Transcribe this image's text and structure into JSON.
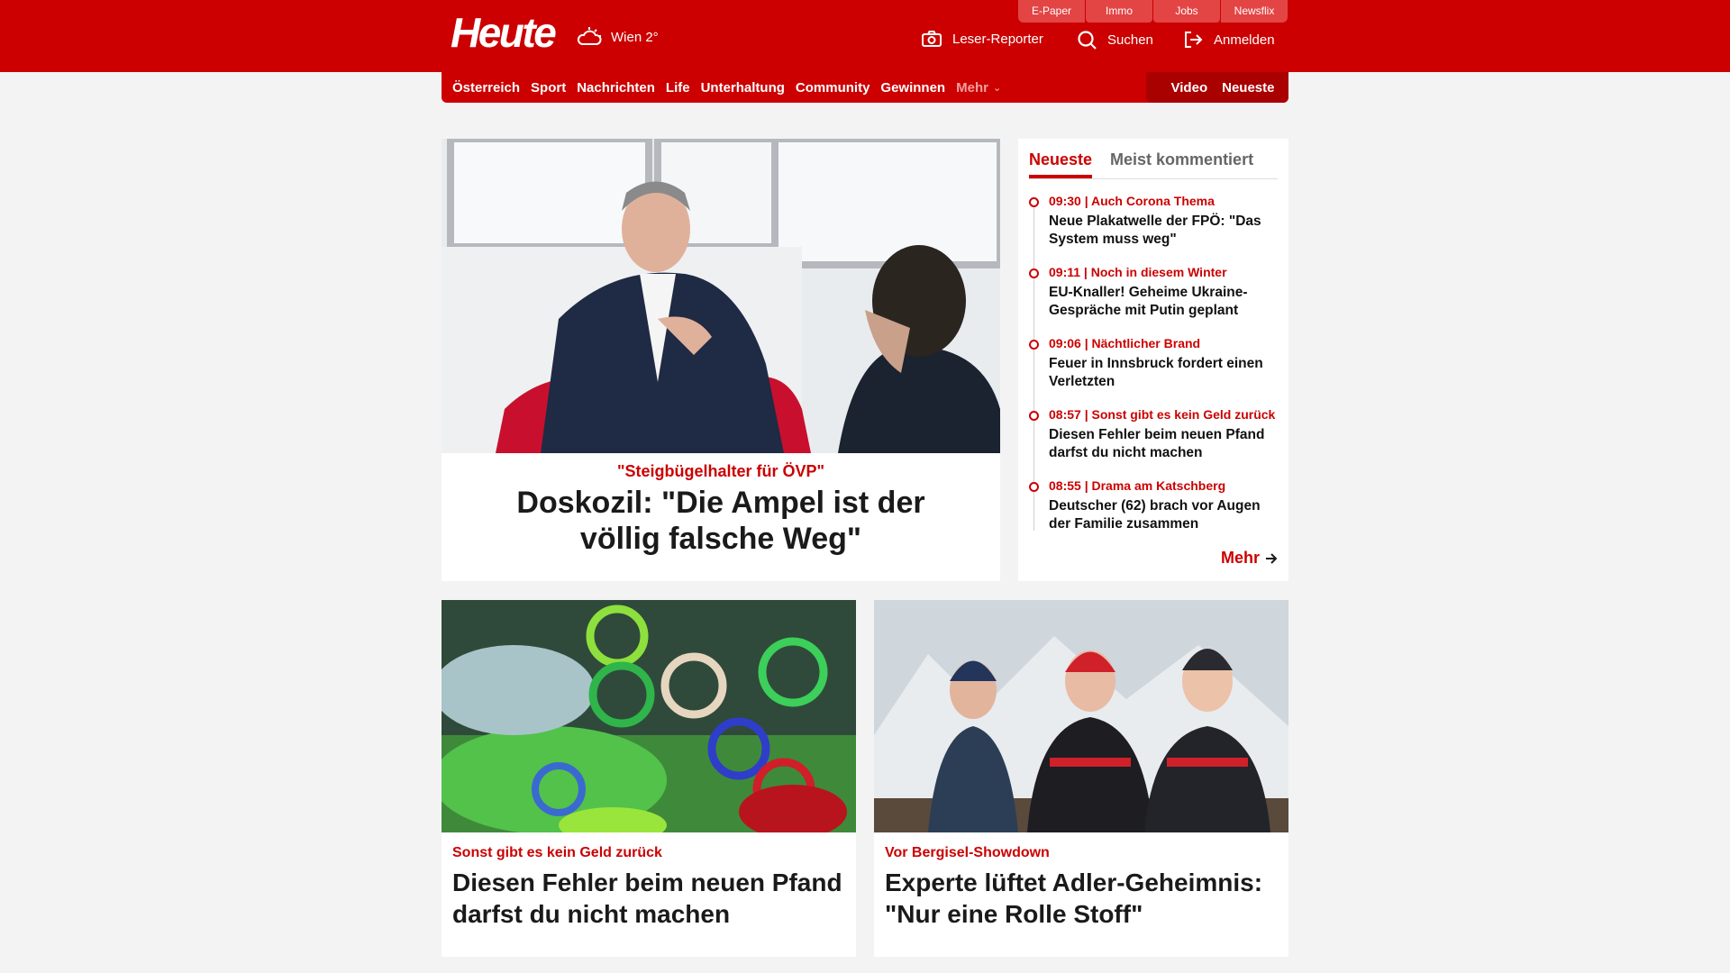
{
  "header": {
    "logo": "Heute",
    "weather": "Wien 2°",
    "quicklinks": [
      "E-Paper",
      "Immo",
      "Jobs",
      "Newsflix"
    ],
    "actions": {
      "reporter": "Leser-Reporter",
      "search": "Suchen",
      "login": "Anmelden"
    }
  },
  "nav": {
    "items": [
      "Österreich",
      "Sport",
      "Nachrichten",
      "Life",
      "Unterhaltung",
      "Community",
      "Gewinnen"
    ],
    "more": "Mehr",
    "right": [
      "Video",
      "Neueste"
    ]
  },
  "lead": {
    "kicker": "\"Steigbügelhalter für ÖVP\"",
    "title": "Doskozil: \"Die Ampel ist der völlig falsche Weg\""
  },
  "sidebar": {
    "tabs": [
      "Neueste",
      "Meist kommentiert"
    ],
    "items": [
      {
        "meta": "09:30 | Auch Corona Thema",
        "title": "Neue Plakatwelle der FPÖ: \"Das System muss weg\""
      },
      {
        "meta": "09:11 | Noch in diesem Winter",
        "title": "EU-Knaller! Geheime Ukraine-Gespräche mit Putin geplant"
      },
      {
        "meta": "09:06 | Nächtlicher Brand",
        "title": "Feuer in Innsbruck fordert einen Verletzten"
      },
      {
        "meta": "08:57 | Sonst gibt es kein Geld zurück",
        "title": "Diesen Fehler beim neuen Pfand darfst du nicht machen"
      },
      {
        "meta": "08:55 | Drama am Katschberg",
        "title": "Deutscher (62) brach vor Augen der Familie zusammen"
      }
    ],
    "more": "Mehr"
  },
  "cards": [
    {
      "kicker": "Sonst gibt es kein Geld zurück",
      "title": "Diesen Fehler beim neuen Pfand darfst du nicht machen"
    },
    {
      "kicker": "Vor Bergisel-Showdown",
      "title": "Experte lüftet Adler-Geheimnis: \"Nur eine Rolle Stoff\""
    }
  ],
  "colors": {
    "brand": "#cc0000",
    "brand_dark": "#a90000",
    "background": "#f3f3f3"
  }
}
